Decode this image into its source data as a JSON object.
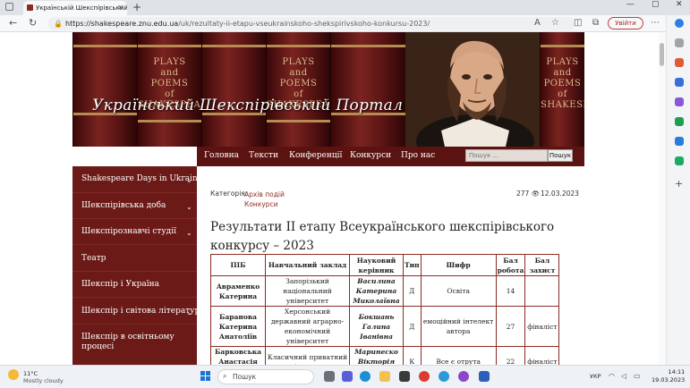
{
  "browser": {
    "tab_title": "Українській Шекспірівський По...",
    "tab_close": "✕",
    "new_tab": "+",
    "url_host": "https://shakespeare.znu.edu.ua",
    "url_path": "/uk/rezultaty-ii-etapu-vseukrainskoho-shekspirivskoho-konkursu-2023/",
    "signin_label": "Увійти",
    "minimize": "—",
    "maximize": "▢",
    "close": "✕",
    "back": "←",
    "reload": "↻"
  },
  "site": {
    "title": "Український Шекспірівський Портал",
    "book_title": "PLAYS\nand\nPOEMS\nof\nSHAKESPEARE",
    "menu": [
      "Головна",
      "Тексти",
      "Конференції",
      "Конкурси",
      "Про нас"
    ],
    "search_placeholder": "Пошук ...",
    "search_button": "Пошук"
  },
  "sidebar": {
    "items": [
      {
        "label": "Shakespeare Days in Ukraine",
        "has_children": true
      },
      {
        "label": "Шекспірівська доба",
        "has_children": true
      },
      {
        "label": "Шекспірознавчі студії",
        "has_children": true
      },
      {
        "label": "Театр",
        "has_children": false
      },
      {
        "label": "Шекспір і Україна",
        "has_children": false
      },
      {
        "label": "Шекспір і світова література",
        "has_children": true
      },
      {
        "label": "Шекспір в освітньому процесі",
        "has_children": false
      }
    ]
  },
  "post": {
    "category_label": "Категорія:",
    "categories": [
      "Архів подій",
      "Конкурси"
    ],
    "views": "277",
    "date": "12.03.2023",
    "heading": "Результати ІІ етапу Всеукраїнського шекспірівського конкурсу – 2023"
  },
  "results_table": {
    "columns": [
      "ПІБ",
      "Навчальний заклад",
      "Науковий керівник",
      "Тип",
      "Шифр",
      "Бал робота",
      "Бал захист"
    ],
    "rows": [
      [
        "Авраменко Катерина",
        "Запорізький національний університет",
        "Василина Катерина Миколаївна",
        "Д",
        "Освіта",
        "14",
        ""
      ],
      [
        "Баранова Катерина Анатоліїв",
        "Херсонський державний аграрно- економічний університет",
        "Бокшань Галина Іванівна",
        "Д",
        "емоційний інтелект автора",
        "27",
        "фіналіст"
      ],
      [
        "Барковська Анастасія Дмитрівна",
        "Класичний приватний університет",
        "Маринеско Вікторія Юріївна",
        "К",
        "Все є отрута",
        "22",
        "фіналіст"
      ]
    ]
  },
  "taskbar": {
    "temp": "11°C",
    "weather": "Mostly cloudy",
    "search": "Пошук",
    "lang": "УКР",
    "time": "14:11",
    "date": "19.03.2023"
  }
}
